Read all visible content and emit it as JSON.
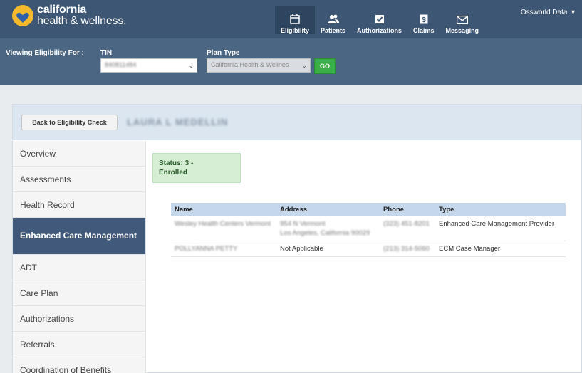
{
  "brand": {
    "line1": "california",
    "line2": "health & wellness."
  },
  "nav": {
    "items": [
      {
        "label": "Eligibility",
        "icon": "calendar-icon",
        "active": true
      },
      {
        "label": "Patients",
        "icon": "users-icon",
        "active": false
      },
      {
        "label": "Authorizations",
        "icon": "checkbox-icon",
        "active": false
      },
      {
        "label": "Claims",
        "icon": "dollar-icon",
        "active": false
      },
      {
        "label": "Messaging",
        "icon": "envelope-icon",
        "active": false
      }
    ],
    "user": "Ossworld Data"
  },
  "filters": {
    "viewing_label": "Viewing Eligibility For :",
    "tin_label": "TIN",
    "tin_value": "840811484",
    "plan_label": "Plan Type",
    "plan_value": "California Health & Wellnes",
    "go_label": "GO"
  },
  "member": {
    "back_label": "Back to Eligibility Check",
    "name": "LAURA L MEDELLIN"
  },
  "sidebar": {
    "items": [
      {
        "label": "Overview"
      },
      {
        "label": "Assessments"
      },
      {
        "label": "Health Record"
      },
      {
        "label": "Enhanced Care Management",
        "active": true
      },
      {
        "label": "ADT"
      },
      {
        "label": "Care Plan"
      },
      {
        "label": "Authorizations"
      },
      {
        "label": "Referrals"
      },
      {
        "label": "Coordination of Benefits"
      }
    ]
  },
  "status": {
    "line1": "Status: 3 -",
    "line2": "Enrolled"
  },
  "table": {
    "headers": [
      "Name",
      "Address",
      "Phone",
      "Type"
    ],
    "rows": [
      {
        "name": "Wesley Health Centers Vermont",
        "address1": "954 N Vermont",
        "address2": "Los Angeles, California 90029",
        "phone": "(323) 451-8201",
        "type": "Enhanced Care Management Provider"
      },
      {
        "name": "POLLYANNA PETTY",
        "address1": "Not Applicable",
        "address2": "",
        "phone": "(213) 314-5060",
        "type": "ECM Case Manager"
      }
    ]
  },
  "colors": {
    "header": "#3c5673",
    "filterbar": "#4a6683",
    "active_side": "#41597a",
    "go": "#3aaf47",
    "status_bg": "#d6efd4"
  }
}
